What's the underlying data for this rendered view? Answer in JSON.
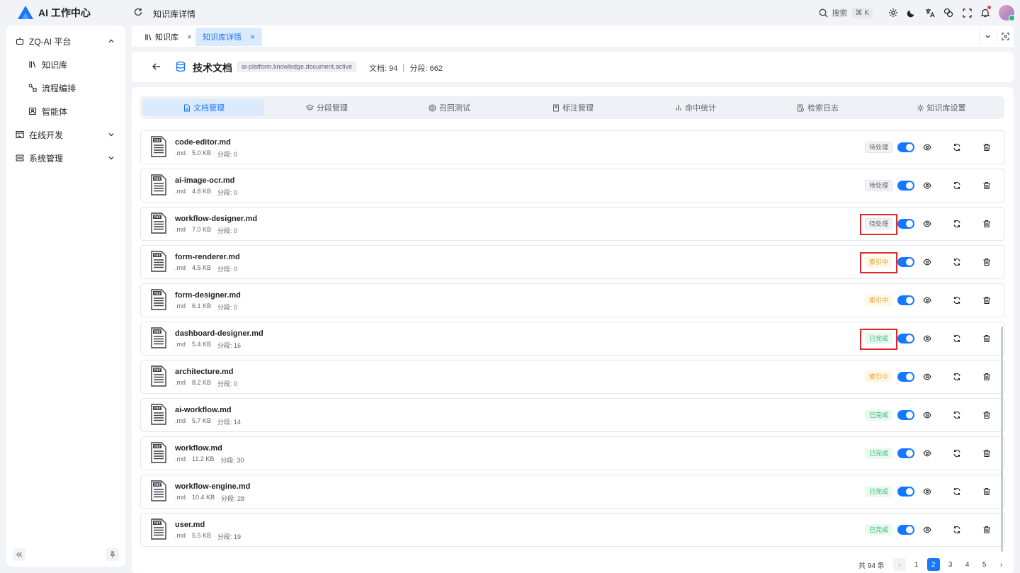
{
  "app": {
    "title": "AI 工作中心",
    "current_page": "知识库详情"
  },
  "topbar": {
    "search_label": "搜索",
    "search_shortcut": "⌘ K",
    "icons": [
      "settings-icon",
      "moon-icon",
      "translate-icon",
      "theme-icon",
      "fullscreen-icon",
      "bell-icon"
    ]
  },
  "sidebar": {
    "groups": [
      {
        "label": "ZQ-AI 平台",
        "expanded": true,
        "items": [
          {
            "label": "知识库"
          },
          {
            "label": "流程编排"
          },
          {
            "label": "智能体"
          }
        ]
      },
      {
        "label": "在线开发",
        "expanded": false
      },
      {
        "label": "系统管理",
        "expanded": false
      }
    ]
  },
  "tabs": [
    {
      "label": "知识库",
      "active": false
    },
    {
      "label": "知识库详情",
      "active": true
    }
  ],
  "header": {
    "name": "技术文档",
    "tag": "ai-platform.knowledge.document.active",
    "stats": "文档: 94 ｜ 分段: 662"
  },
  "subtabs": [
    {
      "label": "文档管理",
      "active": true
    },
    {
      "label": "分段管理"
    },
    {
      "label": "召回测试"
    },
    {
      "label": "标注管理"
    },
    {
      "label": "命中统计"
    },
    {
      "label": "检索日志"
    },
    {
      "label": "知识库设置"
    }
  ],
  "documents": [
    {
      "name": "code-editor.md",
      "ext": ".md",
      "size": "5.0 KB",
      "segments": "分段: 0",
      "status": "待处理",
      "status_type": "pending",
      "highlighted": false
    },
    {
      "name": "ai-image-ocr.md",
      "ext": ".md",
      "size": "4.8 KB",
      "segments": "分段: 0",
      "status": "待处理",
      "status_type": "pending",
      "highlighted": false
    },
    {
      "name": "workflow-designer.md",
      "ext": ".md",
      "size": "7.0 KB",
      "segments": "分段: 0",
      "status": "待处理",
      "status_type": "pending",
      "highlighted": true
    },
    {
      "name": "form-renderer.md",
      "ext": ".md",
      "size": "4.5 KB",
      "segments": "分段: 0",
      "status": "索引中",
      "status_type": "indexing",
      "highlighted": true
    },
    {
      "name": "form-designer.md",
      "ext": ".md",
      "size": "6.1 KB",
      "segments": "分段: 0",
      "status": "索引中",
      "status_type": "indexing",
      "highlighted": false
    },
    {
      "name": "dashboard-designer.md",
      "ext": ".md",
      "size": "5.4 KB",
      "segments": "分段: 16",
      "status": "已完成",
      "status_type": "done",
      "highlighted": true
    },
    {
      "name": "architecture.md",
      "ext": ".md",
      "size": "8.2 KB",
      "segments": "分段: 0",
      "status": "索引中",
      "status_type": "indexing",
      "highlighted": false
    },
    {
      "name": "ai-workflow.md",
      "ext": ".md",
      "size": "5.7 KB",
      "segments": "分段: 14",
      "status": "已完成",
      "status_type": "done",
      "highlighted": false
    },
    {
      "name": "workflow.md",
      "ext": ".md",
      "size": "11.2 KB",
      "segments": "分段: 30",
      "status": "已完成",
      "status_type": "done",
      "highlighted": false
    },
    {
      "name": "workflow-engine.md",
      "ext": ".md",
      "size": "10.4 KB",
      "segments": "分段: 28",
      "status": "已完成",
      "status_type": "done",
      "highlighted": false
    },
    {
      "name": "user.md",
      "ext": ".md",
      "size": "5.5 KB",
      "segments": "分段: 19",
      "status": "已完成",
      "status_type": "done",
      "highlighted": false
    }
  ],
  "pagination": {
    "total": "共 94 条",
    "pages": [
      "1",
      "2",
      "3",
      "4",
      "5"
    ],
    "current": "2"
  },
  "colors": {
    "accent": "#1677ff",
    "highlight": "#e5292b",
    "done": "#2fb56b",
    "indexing": "#e5a23b"
  }
}
